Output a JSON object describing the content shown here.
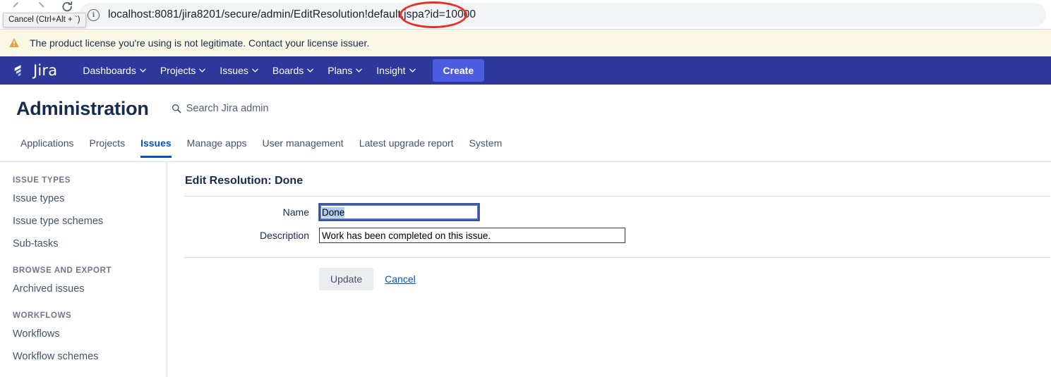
{
  "browser": {
    "back_icon": "back-arrow-icon",
    "forward_icon": "forward-arrow-icon",
    "reload_icon": "reload-icon",
    "tooltip": "Cancel (Ctrl+Alt + `)",
    "site_info_icon": "site-information-icon",
    "url_prefix": "localhost:8081/jira8201/secure/admin/EditResolution!default.jspa",
    "url_query": "?id=10000",
    "annotation_color": "#ef2b22"
  },
  "license_banner": {
    "icon": "warning-triangle-icon",
    "message": "The product license you're using is not legitimate. Contact your license issuer.",
    "background": "#faf8e4",
    "icon_color": "#e8a33d"
  },
  "top_nav": {
    "logo_text": "Jira",
    "background": "#2e389b",
    "items": [
      {
        "label": "Dashboards",
        "has_caret": true
      },
      {
        "label": "Projects",
        "has_caret": true
      },
      {
        "label": "Issues",
        "has_caret": true
      },
      {
        "label": "Boards",
        "has_caret": true
      },
      {
        "label": "Plans",
        "has_caret": true
      },
      {
        "label": "Insight",
        "has_caret": true
      }
    ],
    "create_label": "Create",
    "create_color": "#4c5ce0"
  },
  "admin_header": {
    "title": "Administration",
    "search_icon": "search-icon",
    "search_label": "Search Jira admin"
  },
  "admin_tabs": {
    "active_color": "#0052cc",
    "items": [
      {
        "label": "Applications",
        "active": false
      },
      {
        "label": "Projects",
        "active": false
      },
      {
        "label": "Issues",
        "active": true
      },
      {
        "label": "Manage apps",
        "active": false
      },
      {
        "label": "User management",
        "active": false
      },
      {
        "label": "Latest upgrade report",
        "active": false
      },
      {
        "label": "System",
        "active": false
      }
    ]
  },
  "sidebar": {
    "groups": [
      {
        "title": "ISSUE TYPES",
        "items": [
          {
            "label": "Issue types"
          },
          {
            "label": "Issue type schemes"
          },
          {
            "label": "Sub-tasks"
          }
        ]
      },
      {
        "title": "BROWSE AND EXPORT",
        "items": [
          {
            "label": "Archived issues"
          }
        ]
      },
      {
        "title": "WORKFLOWS",
        "items": [
          {
            "label": "Workflows"
          },
          {
            "label": "Workflow schemes"
          }
        ]
      }
    ]
  },
  "form": {
    "title": "Edit Resolution: Done",
    "name_label": "Name",
    "name_value": "Done",
    "name_focused": true,
    "description_label": "Description",
    "description_value": "Work has been completed on this issue.",
    "update_label": "Update",
    "cancel_label": "Cancel"
  }
}
